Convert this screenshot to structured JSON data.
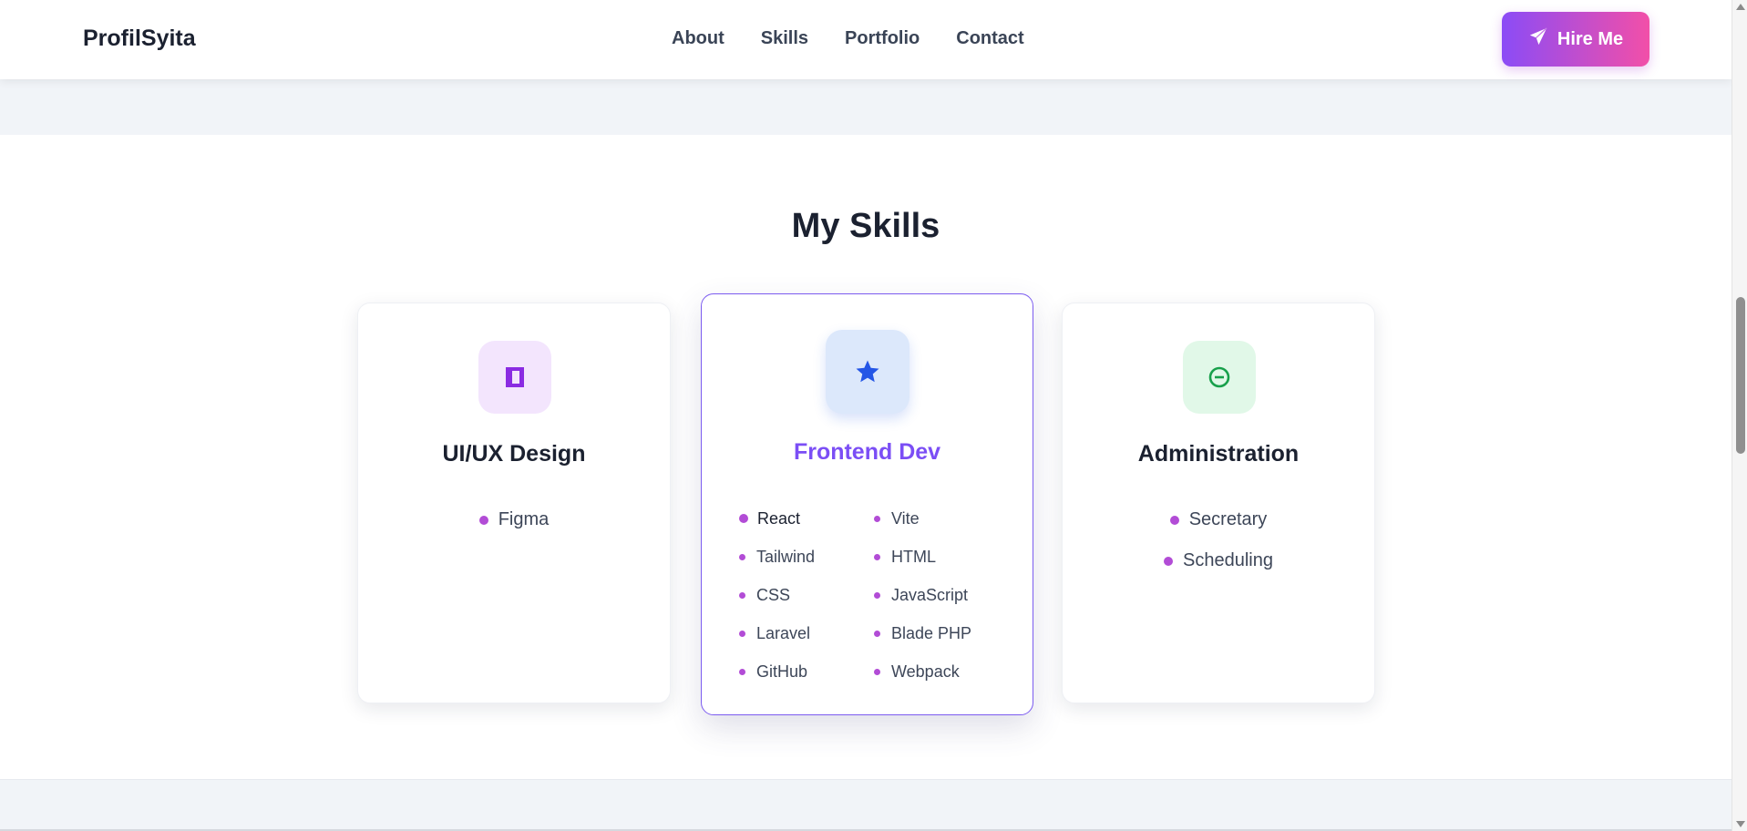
{
  "navbar": {
    "brand": "ProfilSyita",
    "links": [
      "About",
      "Skills",
      "Portfolio",
      "Contact"
    ],
    "cta_label": "Hire Me",
    "cta_icon": "paper-plane-icon"
  },
  "skills": {
    "title": "My Skills",
    "cards": [
      {
        "title": "UI/UX Design",
        "icon": "frame-icon",
        "icon_color": "#8a2be2",
        "icon_bg": "#f3e5fd",
        "items": [
          "Figma"
        ]
      },
      {
        "title": "Frontend Dev",
        "icon": "star-icon",
        "icon_color": "#2456e6",
        "icon_bg": "#dce8fb",
        "items_col1": [
          "React",
          "Tailwind",
          "CSS",
          "Laravel",
          "GitHub"
        ],
        "items_col2": [
          "Vite",
          "HTML",
          "JavaScript",
          "Blade PHP",
          "Webpack"
        ]
      },
      {
        "title": "Administration",
        "icon": "minus-circle-icon",
        "icon_color": "#18a04b",
        "icon_bg": "#e1f8e8",
        "items": [
          "Secretary",
          "Scheduling"
        ]
      }
    ]
  },
  "colors": {
    "accent_purple": "#7b4ef5",
    "bullet": "#b24cd6",
    "cta_gradient_start": "#8b4cf6",
    "cta_gradient_end": "#f24fa8"
  }
}
